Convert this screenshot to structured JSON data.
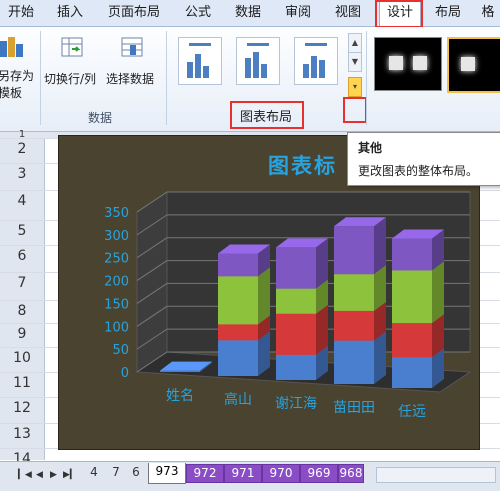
{
  "ribbon_tabs": [
    "开始",
    "插入",
    "页面布局",
    "公式",
    "数据",
    "审阅",
    "视图",
    "设计",
    "布局",
    "格"
  ],
  "ribbon_active_tab": "设计",
  "ribbon_buttons": {
    "save_template": "另存为模板",
    "switch_row_col": "切换行/列",
    "select_data": "选择数据"
  },
  "ribbon_groups": {
    "data": "数据",
    "chart_layouts": "图表布局"
  },
  "tooltip": {
    "title": "其他",
    "desc": "更改图表的整体布局。"
  },
  "row_numbers": [
    "1",
    "2",
    "3",
    "4",
    "5",
    "6",
    "7",
    "8",
    "9",
    "10",
    "11",
    "12",
    "13",
    "14"
  ],
  "chart": {
    "title_partial": "图表标"
  },
  "chart_data": {
    "type": "bar",
    "categories": [
      "姓名",
      "高山",
      "谢江海",
      "苗田田",
      "任远"
    ],
    "series": [
      {
        "values": [
          3,
          78,
          55,
          95,
          67
        ]
      },
      {
        "values": [
          0,
          35,
          90,
          65,
          75
        ]
      },
      {
        "values": [
          0,
          105,
          55,
          80,
          115
        ]
      },
      {
        "values": [
          0,
          50,
          90,
          105,
          70
        ]
      }
    ],
    "yticks": [
      "0",
      "50",
      "100",
      "150",
      "200",
      "250",
      "300",
      "350"
    ],
    "ylim": [
      0,
      350
    ],
    "grid": true,
    "colors": [
      "#4a7fd0",
      "#d63939",
      "#8dc23c",
      "#7e57c2"
    ],
    "axis_label_color": "#27a3e0"
  },
  "sheet_tabs": [
    "4",
    "7",
    "6",
    "973",
    "972",
    "971",
    "970",
    "969",
    "968"
  ],
  "active_sheet": "973",
  "colors": {
    "highlight": "#e8302e",
    "ribbon": "#dfe8f6",
    "chart_bg": "#4a4330"
  }
}
